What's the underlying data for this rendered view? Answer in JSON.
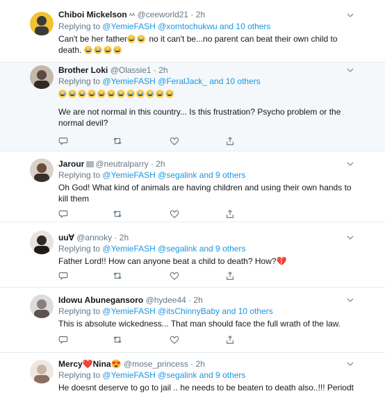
{
  "feed": {
    "tweets": [
      {
        "name": "Chiboi Mickelson",
        "name_suffix": "ᴬᴬ",
        "handle": "@ceeworld21",
        "time": "2h",
        "replying_prefix": "Replying to",
        "replying_links": "@YemieFASH @xomtochukwu and 10 others",
        "text_parts": [
          "Can't be her father",
          " no it can't be...no parent can beat their own child to death."
        ],
        "avatar_color": "#3a3a3a"
      },
      {
        "name": "Brother Loki",
        "handle": "@Olassie1",
        "time": "2h",
        "replying_prefix": "Replying to",
        "replying_links": "@YemieFASH @FeralJack_ and 10 others",
        "text": "We are not normal in this country... Is this frustration? Psycho problem or the normal devil?",
        "emoji_count": 12,
        "avatar_color": "#5b4a3f"
      },
      {
        "name": "Jarour",
        "handle": "@neutralparry",
        "time": "2h",
        "replying_prefix": "Replying to",
        "replying_links": "@YemieFASH @segalink and 9 others",
        "text": "Oh God! What kind of animals are having children and using their own hands to kill them",
        "avatar_color": "#6b4b3a"
      },
      {
        "name": "uu∀",
        "handle": "@annoky",
        "time": "2h",
        "replying_prefix": "Replying to",
        "replying_links": "@YemieFASH @segalink and 9 others",
        "text": "Father Lord!! How can anyone beat a child to death? How?",
        "text_emoji": "💔",
        "avatar_color": "#2e2a2a"
      },
      {
        "name": "Idowu Abunegansoro",
        "handle": "@hydee44",
        "time": "2h",
        "replying_prefix": "Replying to",
        "replying_links": "@YemieFASH @itsChinnyBaby and 10 others",
        "text": "This is absolute wickedness... That man should face the full wrath of the law.",
        "avatar_color": "#8a7f78"
      },
      {
        "name_a": "Mercy",
        "name_b": "Nina",
        "name_heart": "❤️",
        "name_emoji": "😍",
        "handle": "@mose_princess",
        "time": "2h",
        "replying_prefix": "Replying to",
        "replying_links": "@YemieFASH @segalink and 9 others",
        "text": "He doesnt deserve to go to jail .. he needs to be beaten to death also..!!! Periodt",
        "avatar_color": "#c9b2a6"
      }
    ]
  },
  "icons": {
    "reply": "reply-icon",
    "retweet": "retweet-icon",
    "like": "heart-icon",
    "share": "share-icon",
    "more": "chevron-down-icon"
  },
  "colors": {
    "link": "#1b95e0",
    "muted": "#657786",
    "highlight_bg": "#f5f8fa",
    "border": "#e6ecf0"
  }
}
